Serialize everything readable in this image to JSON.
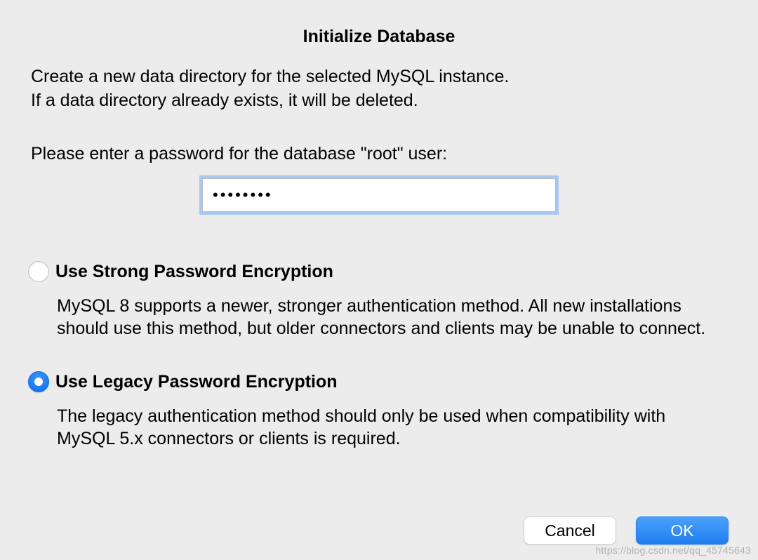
{
  "dialog": {
    "title": "Initialize Database",
    "description_line1": "Create a new data directory for the selected MySQL instance.",
    "description_line2": "If a data directory already exists, it will be deleted.",
    "password_prompt": "Please enter a password for the database \"root\" user:",
    "password_value": "••••••••"
  },
  "options": {
    "strong": {
      "title": "Use Strong Password Encryption",
      "description": "MySQL 8 supports a newer, stronger authentication method. All new installations should use this method, but older connectors and clients may be unable to connect.",
      "selected": false
    },
    "legacy": {
      "title": "Use Legacy Password Encryption",
      "description": "The legacy authentication method should only be used when compatibility with MySQL 5.x connectors or clients is required.",
      "selected": true
    }
  },
  "buttons": {
    "cancel": "Cancel",
    "ok": "OK"
  },
  "watermark": "https://blog.csdn.net/qq_45745643"
}
